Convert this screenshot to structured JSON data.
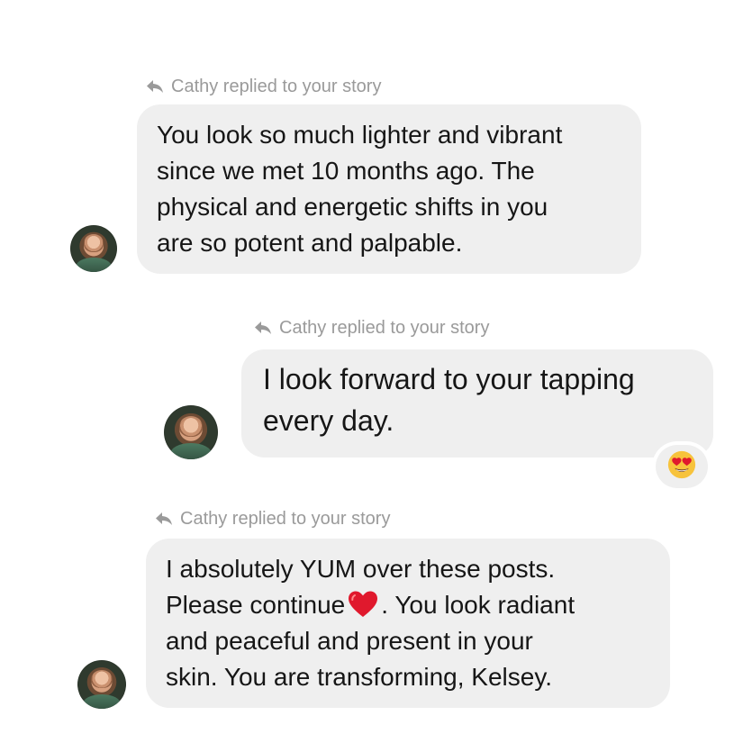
{
  "conversation": {
    "messages": [
      {
        "reply_note": "Cathy replied to your story",
        "lines": [
          "You look so much lighter and vibrant",
          "since we met 10 months ago. The",
          "physical and energetic shifts in you",
          "are so potent and palpable."
        ]
      },
      {
        "reply_note": "Cathy replied to your story",
        "lines": [
          "I look forward to your tapping",
          "every day."
        ],
        "reaction": "heart-eyes-emoji"
      },
      {
        "reply_note": "Cathy replied to your story",
        "lines": [
          "I absolutely YUM over these posts.",
          "Please continue",
          ".  You look radiant",
          "and peaceful and present in your",
          "skin. You are transforming, Kelsey."
        ],
        "inline_emoji": "red-heart-emoji"
      }
    ]
  },
  "icons": {
    "reply": "reply-arrow-icon",
    "avatar": "avatar"
  },
  "colors": {
    "bubble": "#efefef",
    "reply_note_text": "#9a9a9a",
    "message_text": "#161616",
    "heart": "#e0192d"
  }
}
